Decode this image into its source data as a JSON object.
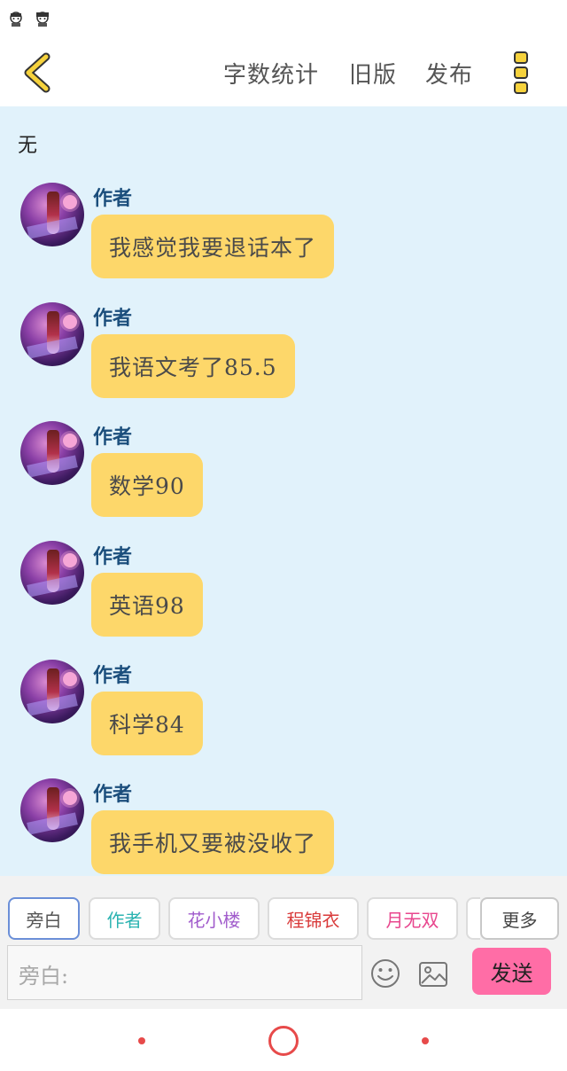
{
  "status_bar": {
    "icons": [
      "avatar-sticker-icon",
      "avatar-sticker-icon"
    ]
  },
  "top_bar": {
    "back_icon": "chevron-left-icon",
    "actions": [
      "字数统计",
      "旧版",
      "发布"
    ],
    "menu_icon": "vertical-dots-icon",
    "accent_color": "#f6d23c"
  },
  "chat": {
    "title": "无",
    "background": "#e1f2fb",
    "bubble_color": "#fdd76a",
    "messages": [
      {
        "sender": "作者",
        "text": "我感觉我要退话本了"
      },
      {
        "sender": "作者",
        "text": "我语文考了85.5"
      },
      {
        "sender": "作者",
        "text": "数学90"
      },
      {
        "sender": "作者",
        "text": "英语98"
      },
      {
        "sender": "作者",
        "text": "科学84"
      },
      {
        "sender": "作者",
        "text": "我手机又要被没收了"
      }
    ]
  },
  "roles": {
    "chips": [
      {
        "label": "旁白",
        "color": "#555555"
      },
      {
        "label": "作者",
        "color": "#2bb3b1"
      },
      {
        "label": "花小楼",
        "color": "#a15ccc"
      },
      {
        "label": "程锦衣",
        "color": "#d93a3a"
      },
      {
        "label": "月无双",
        "color": "#e8478e"
      }
    ],
    "more_label": "更多"
  },
  "composer": {
    "placeholder": "旁白:",
    "emoji_icon": "smiley-icon",
    "image_icon": "image-icon",
    "send_label": "发送",
    "send_color": "#ff6da6"
  },
  "nav_bar": {
    "icons": [
      "back-dot-icon",
      "home-circle-icon",
      "recents-dot-icon"
    ],
    "color": "#e74a4a"
  }
}
